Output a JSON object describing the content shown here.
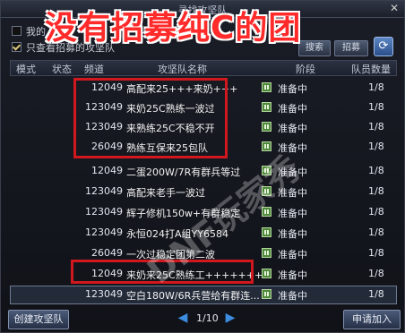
{
  "window": {
    "title": "寻找攻坚队",
    "close_glyph": "✕"
  },
  "overlay_caption": "没有招募纯C的团",
  "options": [
    {
      "label": "我的",
      "checked": false
    },
    {
      "label": "只查看招募的攻坚队",
      "checked": true
    }
  ],
  "buttons": {
    "search": "搜索",
    "recruit": "招募",
    "refresh_glyph": "⟳",
    "create": "创建攻坚队",
    "apply": "申请加入"
  },
  "columns": [
    "模式",
    "状态",
    "频道",
    "攻坚队名称",
    "阶段",
    "队员数量"
  ],
  "rows": [
    {
      "channel": "12049",
      "name": "高配来25+++来奶+++",
      "phase": "准备中",
      "count": "1/8"
    },
    {
      "channel": "123049",
      "name": "来奶25C熟练一波过",
      "phase": "准备中",
      "count": "1/8"
    },
    {
      "channel": "123049",
      "name": "来熟练25C不稳不开",
      "phase": "准备中",
      "count": "1/8"
    },
    {
      "channel": "26049",
      "name": "熟练互保来25包队",
      "phase": "准备中",
      "count": "1/8"
    },
    {
      "channel": "12049",
      "name": "二蛋200W/7R有群兵等过",
      "phase": "准备中",
      "count": "1/8"
    },
    {
      "channel": "123049",
      "name": "高配来老手一波过",
      "phase": "准备中",
      "count": "1/8"
    },
    {
      "channel": "123049",
      "name": "辉子修机150w+有群稳定",
      "phase": "准备中",
      "count": "1/8"
    },
    {
      "channel": "123049",
      "name": "永恒024打A组YY6584",
      "phase": "准备中",
      "count": "1/8"
    },
    {
      "channel": "26049",
      "name": "一次过稳定团第二波",
      "phase": "准备中",
      "count": "1/8"
    },
    {
      "channel": "12049",
      "name": "来奶来25C熟练工++++++++",
      "phase": "准备中",
      "count": "1/8"
    },
    {
      "channel": "123049",
      "name": "空白180W/6R兵营给有群连...",
      "phase": "准备中",
      "count": "1/8"
    }
  ],
  "pager": {
    "text": "1/10",
    "prev_glyph": "◀",
    "next_glyph": "▶"
  },
  "watermark": "DNF玩家秀",
  "colors": {
    "accent_red": "#d0181e",
    "status_green": "#4f8a3c"
  }
}
